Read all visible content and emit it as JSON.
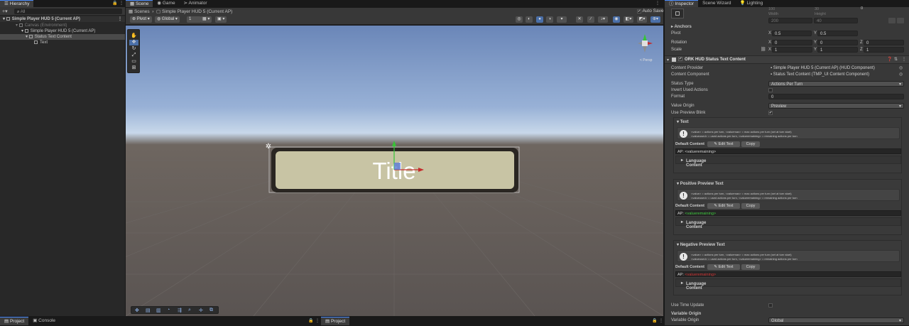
{
  "hierarchy": {
    "tab_label": "Hierarchy",
    "search_placeholder": "All",
    "rows": [
      {
        "label": "Simple Player HUD 5 (Current AP)"
      },
      {
        "label": "Canvas (Environment)"
      },
      {
        "label": "Simple Player HUD 5 (Current AP)"
      },
      {
        "label": "Status Text Content"
      },
      {
        "label": "Text"
      }
    ]
  },
  "scene": {
    "tabs": [
      {
        "label": "Scene"
      },
      {
        "label": "Game"
      },
      {
        "label": "Animator"
      }
    ],
    "breadcrumb": {
      "root": "Scenes",
      "current": "Simple Player HUD 5 (Current AP)"
    },
    "auto_save_label": "Auto Save",
    "toolbar": {
      "pivot": "Pivot",
      "global": "Global",
      "step": "1"
    },
    "canvas_title": "Title",
    "persp_label": "< Persp"
  },
  "bottom": {
    "left_tabs": [
      {
        "label": "Project"
      },
      {
        "label": "Console"
      }
    ],
    "mid_tabs": [
      {
        "label": "Project"
      }
    ]
  },
  "inspector": {
    "tabs": [
      {
        "label": "Inspector"
      },
      {
        "label": "Scene Wizard"
      },
      {
        "label": "Lighting"
      }
    ],
    "rect": {
      "top_values": [
        "100",
        "30",
        "0"
      ],
      "width_label": "Width",
      "height_label": "Height",
      "width": "200",
      "height": "40"
    },
    "anchors_label": "Anchors",
    "pivot": {
      "label": "Pivot",
      "x": "0.5",
      "y": "0.5"
    },
    "rotation": {
      "label": "Rotation",
      "x": "0",
      "y": "0",
      "z": "0"
    },
    "scale": {
      "label": "Scale",
      "x": "1",
      "y": "1",
      "z": "1"
    },
    "component": {
      "title": "ORK HUD Status Text Content",
      "content_provider": {
        "label": "Content Provider",
        "value": "Simple Player HUD 5 (Current AP) (HUD Component)"
      },
      "content_component": {
        "label": "Content Component",
        "value": "Status Text Content (TMP_UI Content Component)"
      },
      "status_type": {
        "label": "Status Type",
        "value": "Actions Per Turn"
      },
      "invert_used": {
        "label": "Invert Used Actions"
      },
      "format": {
        "label": "Format",
        "value": "0"
      },
      "value_origin": {
        "label": "Value Origin",
        "value": "Preview"
      },
      "use_preview_blink": {
        "label": "Use Preview Blink",
        "check": "✔"
      },
      "help_line1": "<value> = actions per turn, <valuemax> = max actions per turn (set at turn start)",
      "help_line2": "<valueused> = used actions per turn, <valueremaining> = remaining actions per turn",
      "default_content_label": "Default Content",
      "edit_text_label": "Edit Text",
      "copy_label": "Copy",
      "language_content_label": "Language Content",
      "sections": [
        {
          "title": "Text",
          "ap_prefix": "AP: ",
          "ap_value": "<valueremaining>",
          "color": "#d0d0d0"
        },
        {
          "title": "Positive Preview Text",
          "ap_prefix": "AP: ",
          "ap_value": "<valueremaining>",
          "color": "#3ec83e"
        },
        {
          "title": "Negative Preview Text",
          "ap_prefix": "AP: ",
          "ap_value": "<valueremaining>",
          "color": "#d23434"
        }
      ],
      "use_time_update": {
        "label": "Use Time Update"
      },
      "variable_origin_header": "Variable Origin",
      "variable_origin": {
        "label": "Variable Origin",
        "value": "Global"
      }
    }
  },
  "colors": {
    "accent": "#4a8cff",
    "panel": "#383838",
    "field": "#2a2a2a"
  }
}
